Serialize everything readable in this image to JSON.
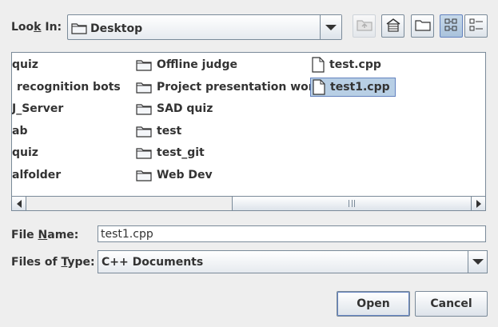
{
  "lookin": {
    "label_prefix": "Loo",
    "label_mnemonic": "k",
    "label_suffix": " In:",
    "value": "Desktop"
  },
  "toolbar": {
    "icons": [
      "up-folder-icon",
      "home-icon",
      "new-folder-icon",
      "list-view-icon",
      "details-view-icon"
    ],
    "list_view_selected": true
  },
  "files": {
    "column1": [
      "quiz",
      "recognition bots",
      "J_Server",
      "ab",
      "quiz",
      "alfolder"
    ],
    "column2": [
      "Offline judge",
      "Project presentation workd",
      "SAD quiz",
      "test",
      "test_git",
      "Web Dev"
    ],
    "column3": [
      "test.cpp",
      "test1.cpp"
    ],
    "selected": "test1.cpp"
  },
  "filename": {
    "label_prefix": "File ",
    "label_mnemonic": "N",
    "label_suffix": "ame:",
    "value": "test1.cpp"
  },
  "filetype": {
    "label_prefix": "Files of ",
    "label_mnemonic": "T",
    "label_suffix": "ype:",
    "value": "C++ Documents"
  },
  "buttons": {
    "open": "Open",
    "cancel": "Cancel"
  },
  "colors": {
    "background": "#eeeeee",
    "selection": "#b8cfe5",
    "border": "#7a8a99"
  }
}
